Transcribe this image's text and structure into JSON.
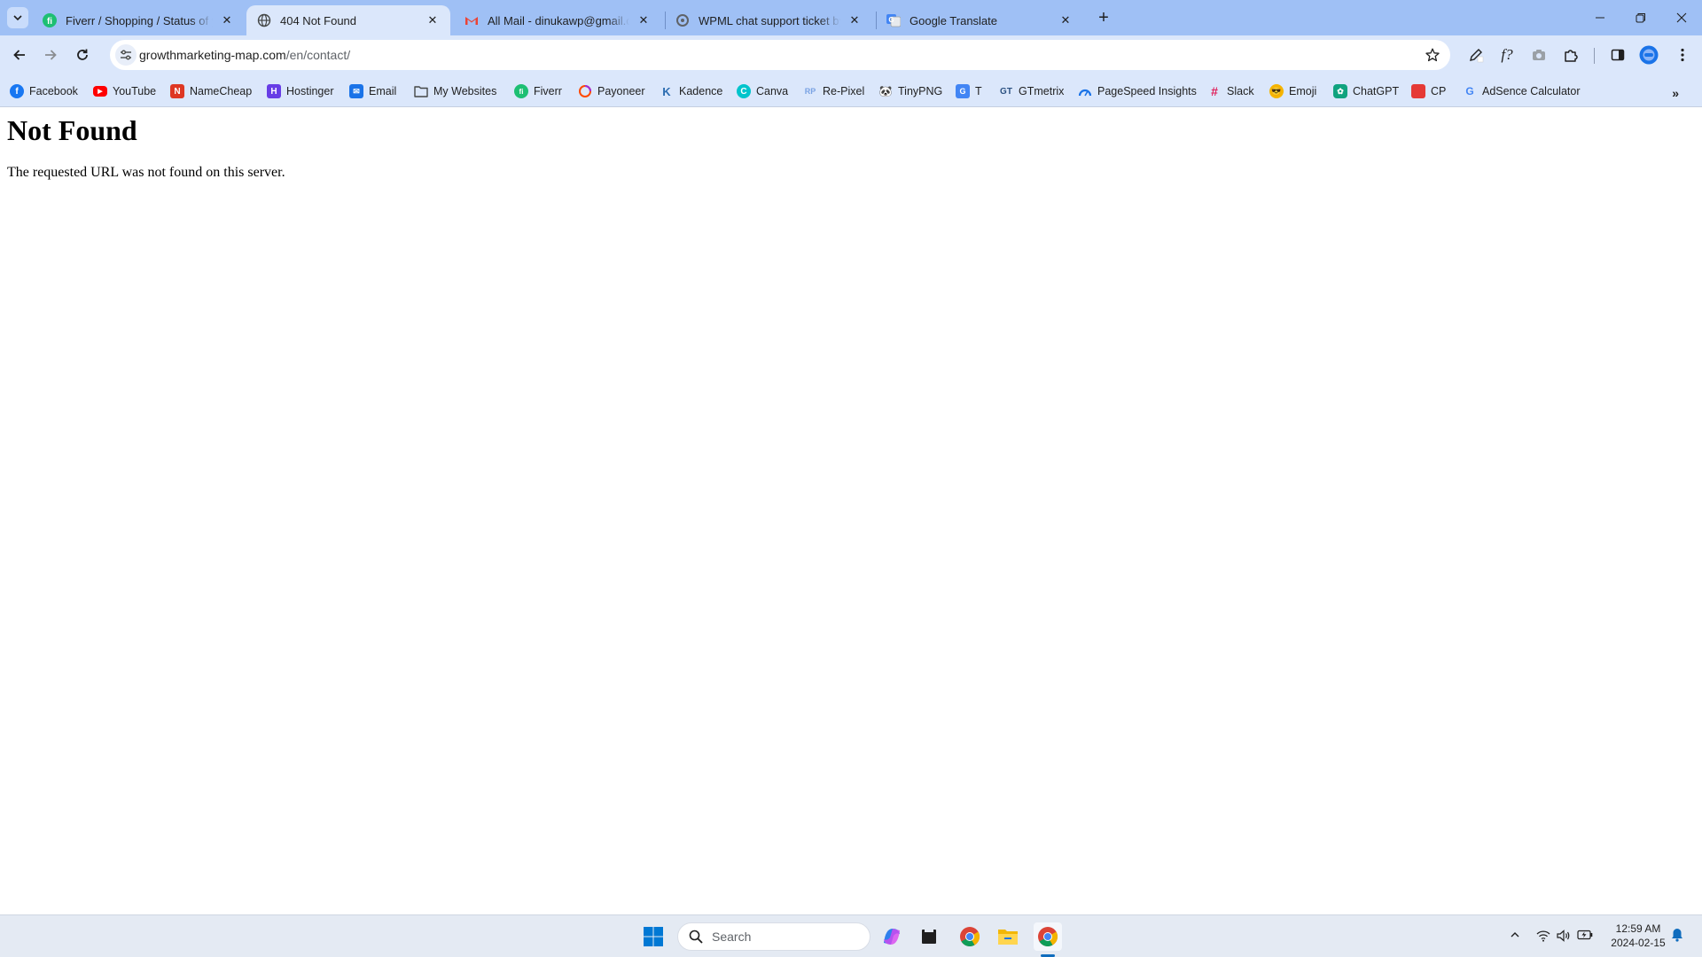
{
  "browser": {
    "tabs": [
      {
        "title": "Fiverr / Shopping / Status of your order",
        "favicon": "fiverr-icon",
        "active": false
      },
      {
        "title": "404 Not Found",
        "favicon": "globe-icon",
        "active": true
      },
      {
        "title": "All Mail - dinukawp@gmail.com",
        "favicon": "gmail-icon",
        "active": false
      },
      {
        "title": "WPML chat support ticket by Dinuka",
        "favicon": "wpml-icon",
        "active": false
      },
      {
        "title": "Google Translate",
        "favicon": "google-translate-icon",
        "active": false
      }
    ],
    "address_bar": {
      "domain": "growthmarketing-map.com",
      "path": "/en/contact/"
    },
    "bookmarks": [
      {
        "label": "Facebook",
        "icon": "facebook-icon",
        "color": "#1877f2"
      },
      {
        "label": "YouTube",
        "icon": "youtube-icon",
        "color": "#ff0000"
      },
      {
        "label": "NameCheap",
        "icon": "namecheap-icon",
        "color": "#de3723"
      },
      {
        "label": "Hostinger",
        "icon": "hostinger-icon",
        "color": "#673de6"
      },
      {
        "label": "Email",
        "icon": "email-icon",
        "color": "#1a73e8"
      },
      {
        "label": "My Websites",
        "icon": "folder-icon",
        "color": "#444746"
      },
      {
        "label": "Fiverr",
        "icon": "fiverr-icon",
        "color": "#1dbf73"
      },
      {
        "label": "Payoneer",
        "icon": "payoneer-icon",
        "color": "#ff4800"
      },
      {
        "label": "Kadence",
        "icon": "kadence-icon",
        "color": "#2b6cb0"
      },
      {
        "label": "Canva",
        "icon": "canva-icon",
        "color": "#00c4cc"
      },
      {
        "label": "Re-Pixel",
        "icon": "repixel-icon",
        "color": "#7aa2e3"
      },
      {
        "label": "TinyPNG",
        "icon": "tinypng-icon",
        "color": "#333333"
      },
      {
        "label": "T",
        "icon": "translate-icon",
        "color": "#4285f4"
      },
      {
        "label": "GTmetrix",
        "icon": "gtmetrix-icon",
        "color": "#2c5282"
      },
      {
        "label": "PageSpeed Insights",
        "icon": "pagespeed-icon",
        "color": "#1a73e8"
      },
      {
        "label": "Slack",
        "icon": "slack-icon",
        "color": "#4a154b"
      },
      {
        "label": "Emoji",
        "icon": "emoji-icon",
        "color": "#f5b400"
      },
      {
        "label": "ChatGPT",
        "icon": "chatgpt-icon",
        "color": "#10a37f"
      },
      {
        "label": "CP",
        "icon": "cp-icon",
        "color": "#e53935"
      },
      {
        "label": "AdSence Calculator",
        "icon": "google-icon",
        "color": "#4285f4"
      }
    ]
  },
  "page": {
    "heading": "Not Found",
    "message": "The requested URL was not found on this server."
  },
  "taskbar": {
    "search_label": "Search",
    "time": "12:59 AM",
    "date": "2024-02-15",
    "accent": "#0f6cbd"
  }
}
